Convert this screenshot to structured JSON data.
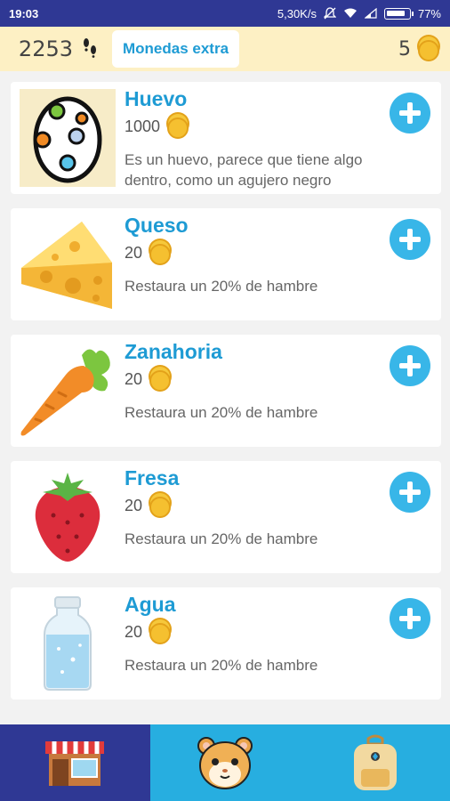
{
  "status_bar": {
    "time": "19:03",
    "network_speed": "5,30K/s",
    "battery": "77%"
  },
  "top_bar": {
    "steps": "2253",
    "steps_icon": "footprints-icon",
    "extra_coins_button": "Monedas extra",
    "coins": "5",
    "coin_icon": "coin-icon"
  },
  "items": [
    {
      "name": "Huevo",
      "price": "1000",
      "description": "Es un huevo, parece que tiene algo dentro, como un agujero negro",
      "icon": "egg-icon"
    },
    {
      "name": "Queso",
      "price": "20",
      "description": "Restaura un 20% de hambre",
      "icon": "cheese-icon"
    },
    {
      "name": "Zanahoria",
      "price": "20",
      "description": "Restaura un 20% de hambre",
      "icon": "carrot-icon"
    },
    {
      "name": "Fresa",
      "price": "20",
      "description": "Restaura un 20% de hambre",
      "icon": "strawberry-icon"
    },
    {
      "name": "Agua",
      "price": "20",
      "description": "Restaura un 20% de hambre",
      "icon": "water-bottle-icon"
    }
  ],
  "bottom_nav": {
    "tabs": [
      {
        "icon": "shop-icon",
        "active": true
      },
      {
        "icon": "hamster-icon",
        "active": false
      },
      {
        "icon": "backpack-icon",
        "active": false
      }
    ]
  },
  "colors": {
    "status_bar": "#2f3894",
    "top_bar": "#fdf0c4",
    "accent": "#1e9bd4",
    "add_button": "#38b6e8",
    "nav_active": "#2f3894",
    "nav_inactive": "#27aee0"
  }
}
